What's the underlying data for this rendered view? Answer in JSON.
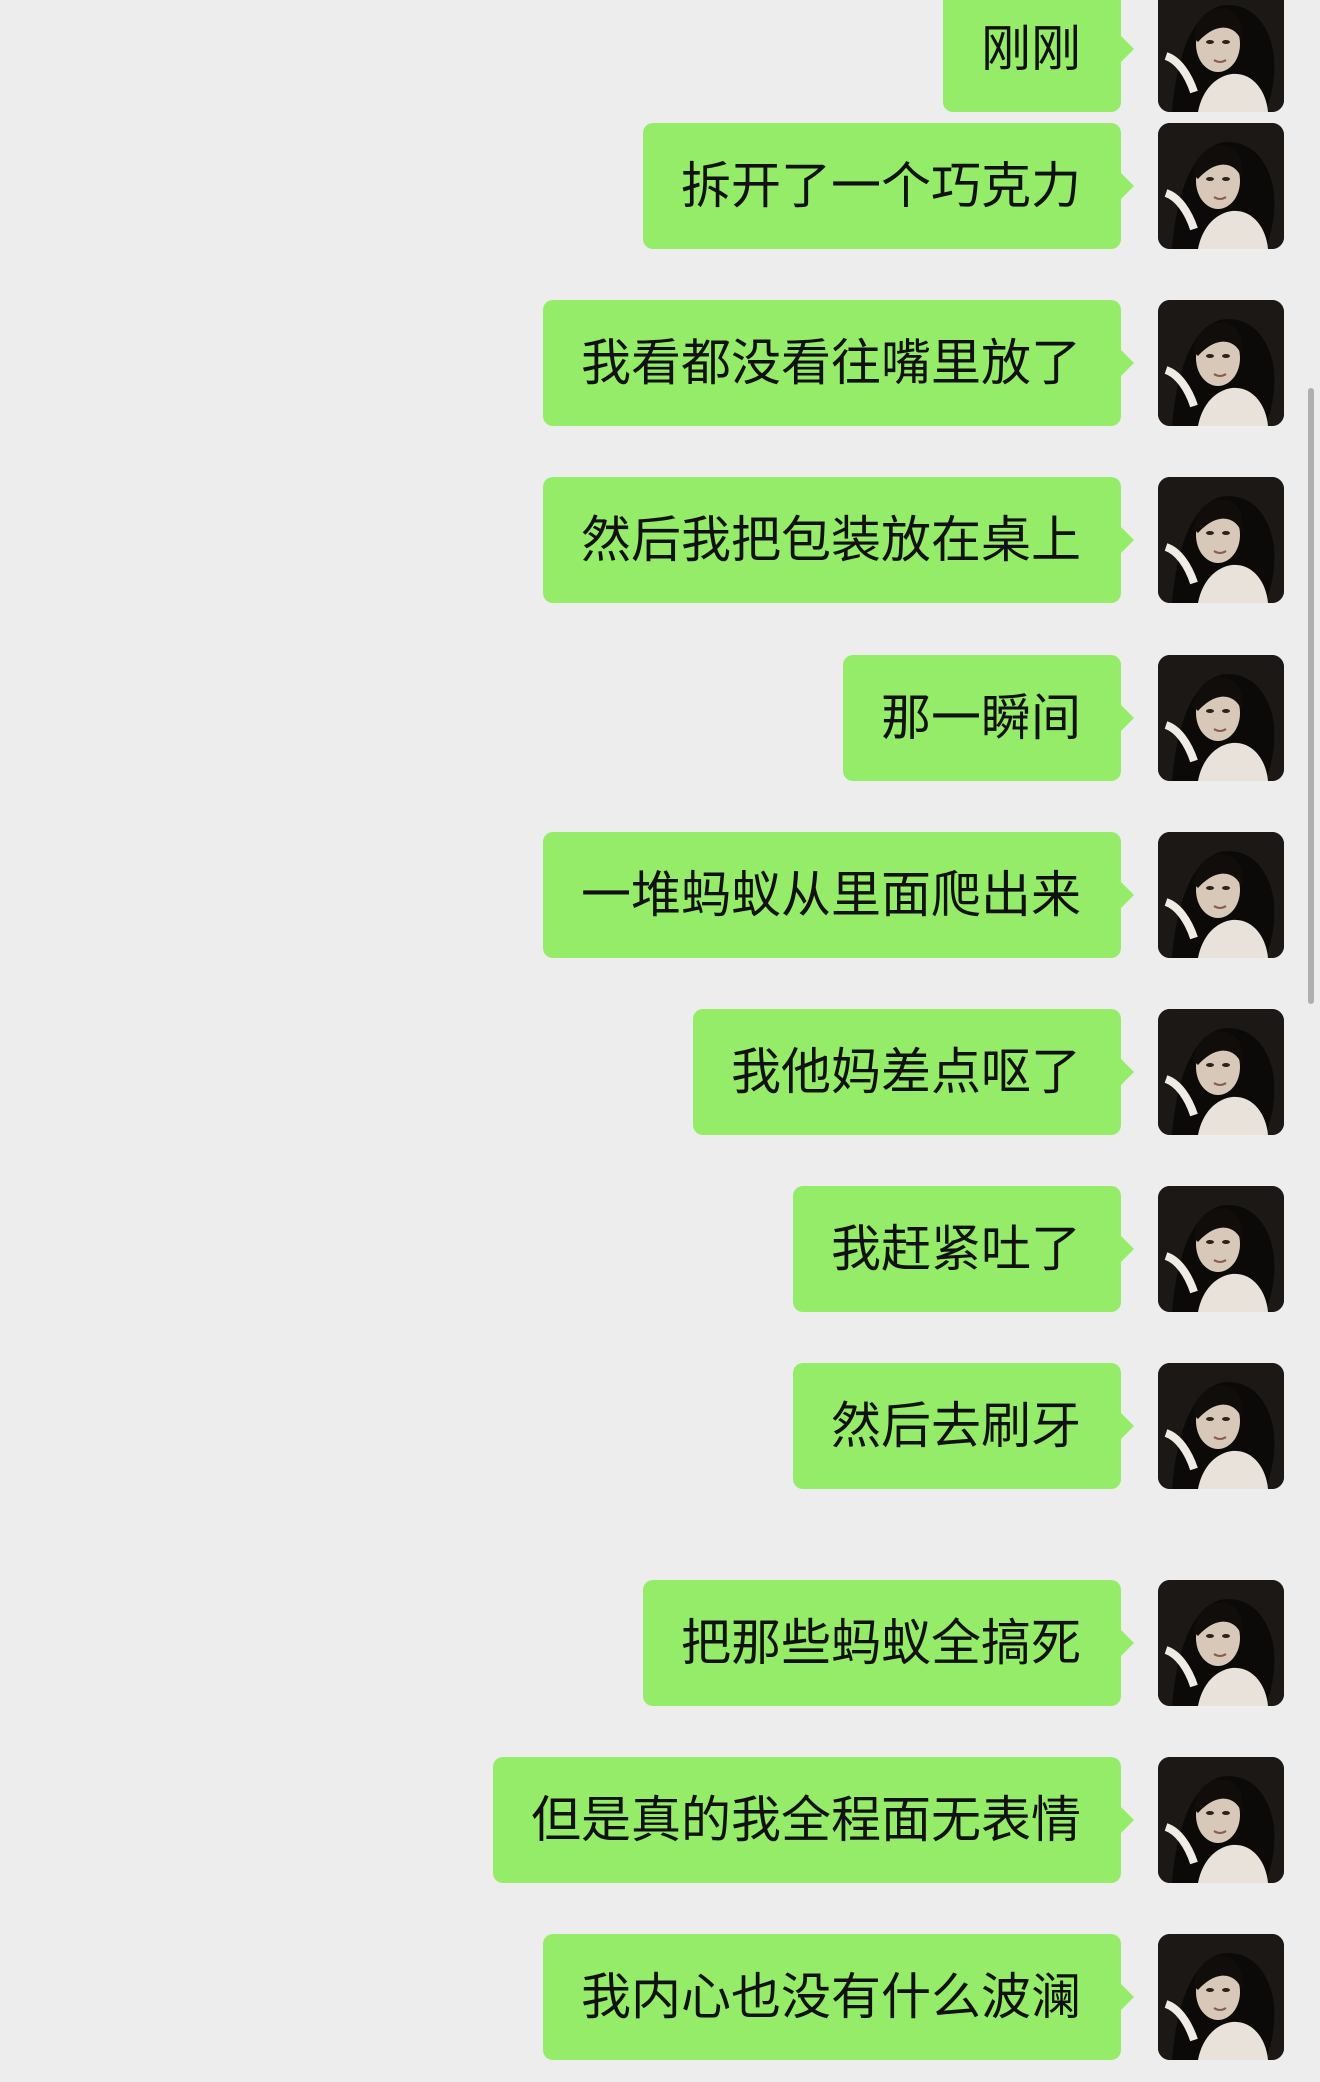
{
  "conversation": {
    "messages": [
      {
        "text": "刚刚",
        "avatar_icon": "user-avatar-icon"
      },
      {
        "text": "拆开了一个巧克力",
        "avatar_icon": "user-avatar-icon"
      },
      {
        "text": "我看都没看往嘴里放了",
        "avatar_icon": "user-avatar-icon"
      },
      {
        "text": "然后我把包装放在桌上",
        "avatar_icon": "user-avatar-icon"
      },
      {
        "text": "那一瞬间",
        "avatar_icon": "user-avatar-icon"
      },
      {
        "text": "一堆蚂蚁从里面爬出来",
        "avatar_icon": "user-avatar-icon"
      },
      {
        "text": "我他妈差点呕了",
        "avatar_icon": "user-avatar-icon"
      },
      {
        "text": "我赶紧吐了",
        "avatar_icon": "user-avatar-icon"
      },
      {
        "text": "然后去刷牙",
        "avatar_icon": "user-avatar-icon"
      },
      {
        "text": "把那些蚂蚁全搞死",
        "avatar_icon": "user-avatar-icon"
      },
      {
        "text": "但是真的我全程面无表情",
        "avatar_icon": "user-avatar-icon"
      },
      {
        "text": "我内心也没有什么波澜",
        "avatar_icon": "user-avatar-icon"
      }
    ]
  },
  "colors": {
    "background": "#ededed",
    "sent_bubble": "#95ec69",
    "text": "#111111"
  }
}
